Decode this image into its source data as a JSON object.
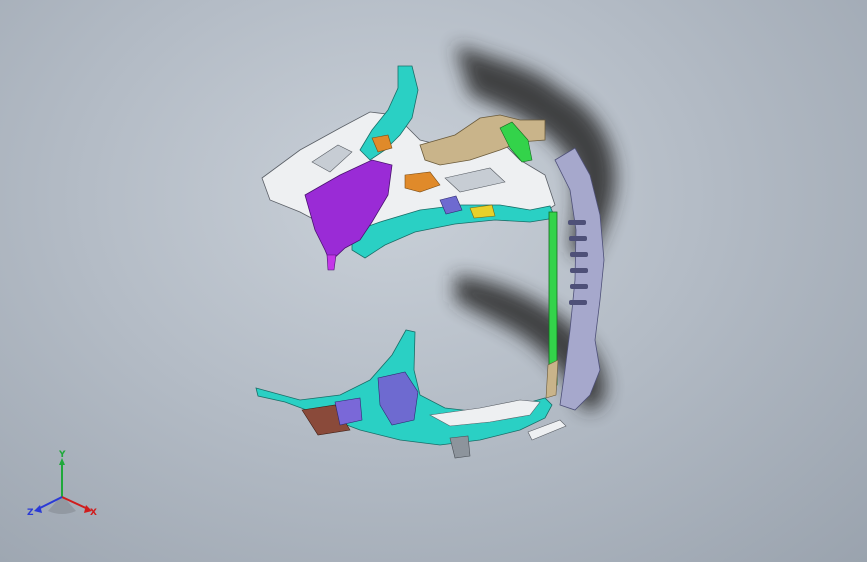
{
  "viewport": {
    "background_top": "#c9d0d8",
    "background_bottom": "#9aa3ae"
  },
  "model": {
    "part_colors": {
      "cyan_panel": "#2ad0c4",
      "purple_bracket": "#9a2bd6",
      "white_frame": "#eef0f2",
      "tan_reinforcement": "#c9b48a",
      "green_rail": "#33d34a",
      "lavender_pillar": "#a6a8cc",
      "orange_plate": "#e08a2a",
      "yellow_clip": "#e8d12a",
      "brown_bracket": "#8a4a3a",
      "blue_plate": "#6e6ad0",
      "shadow": "#2a2a2a"
    }
  },
  "triad": {
    "x_label": "X",
    "y_label": "Y",
    "z_label": "Z",
    "x_color": "#d01c1c",
    "y_color": "#1fa83a",
    "z_color": "#2a3ad6"
  }
}
